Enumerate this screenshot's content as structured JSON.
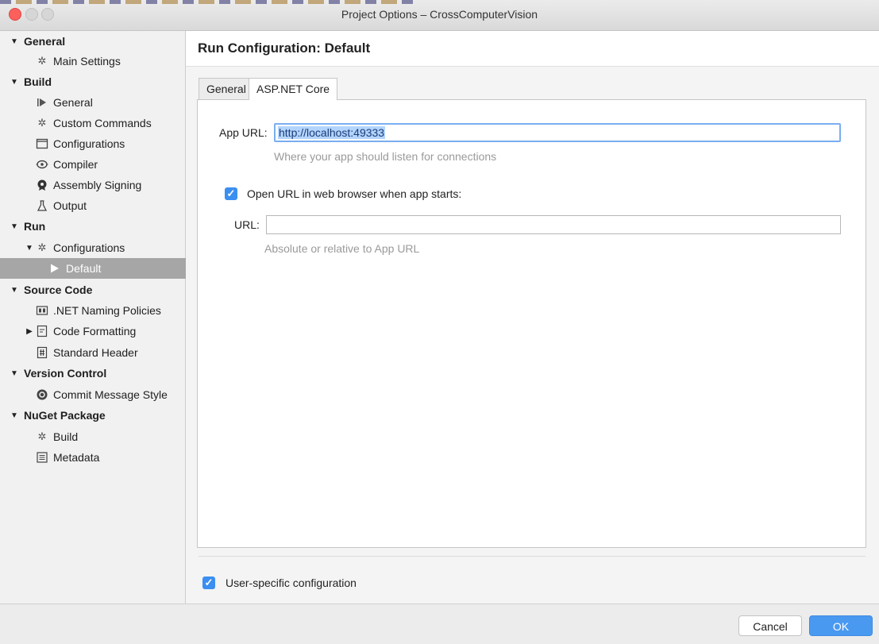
{
  "window": {
    "title": "Project Options – CrossComputerVision"
  },
  "sidebar": {
    "items": [
      {
        "label": "General",
        "type": "category"
      },
      {
        "label": "Main Settings",
        "icon": "gear-icon"
      },
      {
        "label": "Build",
        "type": "category"
      },
      {
        "label": "General",
        "icon": "play-bar-icon"
      },
      {
        "label": "Custom Commands",
        "icon": "gear-icon"
      },
      {
        "label": "Configurations",
        "icon": "window-icon"
      },
      {
        "label": "Compiler",
        "icon": "compiler-icon"
      },
      {
        "label": "Assembly Signing",
        "icon": "seal-icon"
      },
      {
        "label": "Output",
        "icon": "flask-icon"
      },
      {
        "label": "Run",
        "type": "category"
      },
      {
        "label": "Configurations",
        "icon": "gear-icon"
      },
      {
        "label": "Default",
        "icon": "play-icon",
        "selected": true
      },
      {
        "label": "Source Code",
        "type": "category"
      },
      {
        "label": ".NET Naming Policies",
        "icon": "naming-icon"
      },
      {
        "label": "Code Formatting",
        "icon": "document-icon"
      },
      {
        "label": "Standard Header",
        "icon": "header-icon"
      },
      {
        "label": "Version Control",
        "type": "category"
      },
      {
        "label": "Commit Message Style",
        "icon": "commit-icon"
      },
      {
        "label": "NuGet Package",
        "type": "category"
      },
      {
        "label": "Build",
        "icon": "gear-icon"
      },
      {
        "label": "Metadata",
        "icon": "list-icon"
      }
    ]
  },
  "main": {
    "title": "Run Configuration: Default",
    "tabs": [
      "General",
      "ASP.NET Core"
    ],
    "app_url_label": "App URL:",
    "app_url_value": "http://localhost:49333",
    "app_url_hint": "Where your app should listen for connections",
    "open_url_label": "Open URL in web browser when app starts:",
    "open_url_checked": true,
    "url_label": "URL:",
    "url_value": "",
    "url_hint": "Absolute or relative to App URL",
    "user_specific_label": "User-specific configuration",
    "user_specific_checked": true
  },
  "footer": {
    "cancel_label": "Cancel",
    "ok_label": "OK"
  },
  "colors": {
    "accent": "#3b8ff0",
    "selection": "#a6a6a6",
    "close_button": "#fc605c"
  }
}
